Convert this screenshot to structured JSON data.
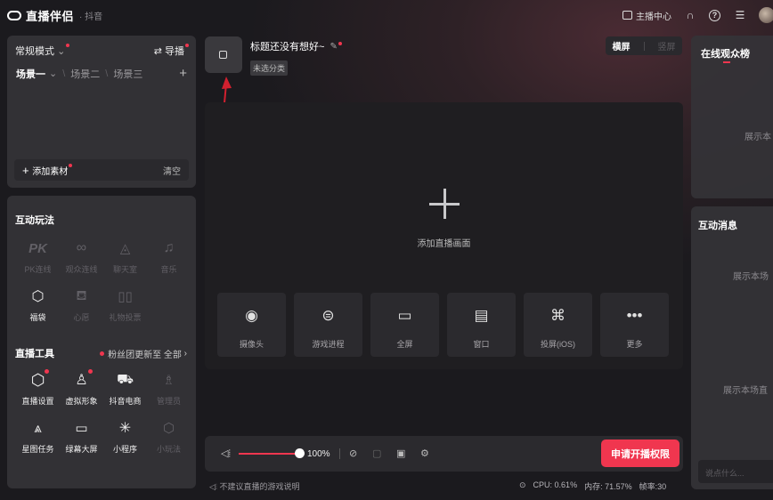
{
  "app": {
    "name": "直播伴侣",
    "platform": "· 抖音"
  },
  "titlebar": {
    "anchor_center": "主播中心",
    "help": "?"
  },
  "scene_panel": {
    "mode_label": "常规模式",
    "guide_label": "导播",
    "scenes": [
      "场景一",
      "场景二",
      "场景三"
    ],
    "add_material": "添加素材",
    "clear": "清空"
  },
  "interactive": {
    "title": "互动玩法",
    "items": [
      {
        "label": "PK连线",
        "icon": "pk-icon",
        "enabled": false
      },
      {
        "label": "观众连线",
        "icon": "link-icon",
        "enabled": false
      },
      {
        "label": "聊天室",
        "icon": "chatroom-icon",
        "enabled": false
      },
      {
        "label": "音乐",
        "icon": "music-icon",
        "enabled": false
      },
      {
        "label": "福袋",
        "icon": "lucky-bag-icon",
        "enabled": true
      },
      {
        "label": "心愿",
        "icon": "wish-icon",
        "enabled": false
      },
      {
        "label": "礼物投票",
        "icon": "gift-vote-icon",
        "enabled": false
      }
    ]
  },
  "tools": {
    "title": "直播工具",
    "fans_update": "粉丝团更新至",
    "all": "全部",
    "items": [
      {
        "label": "直播设置",
        "icon": "settings-icon",
        "enabled": true,
        "badge": true
      },
      {
        "label": "虚拟形象",
        "icon": "avatar-icon",
        "enabled": true,
        "badge": true
      },
      {
        "label": "抖音电商",
        "icon": "cart-icon",
        "enabled": true,
        "badge": false
      },
      {
        "label": "管理员",
        "icon": "admin-icon",
        "enabled": false,
        "badge": false
      },
      {
        "label": "星图任务",
        "icon": "star-task-icon",
        "enabled": true,
        "badge": false
      },
      {
        "label": "绿幕大屏",
        "icon": "green-screen-icon",
        "enabled": true,
        "badge": false
      },
      {
        "label": "小程序",
        "icon": "mini-program-icon",
        "enabled": true,
        "badge": false
      },
      {
        "label": "小玩法",
        "icon": "mini-game-icon",
        "enabled": false,
        "badge": false
      }
    ]
  },
  "stream": {
    "title": "标题还没有想好~",
    "category": "未选分类",
    "orientation": {
      "landscape": "横屏",
      "portrait": "竖屏"
    }
  },
  "canvas": {
    "add_label": "添加直播画面",
    "sources": [
      {
        "label": "摄像头",
        "icon": "camera-icon"
      },
      {
        "label": "游戏进程",
        "icon": "gamepad-icon"
      },
      {
        "label": "全屏",
        "icon": "monitor-icon"
      },
      {
        "label": "窗口",
        "icon": "window-icon"
      },
      {
        "label": "投屏(iOS)",
        "icon": "apple-icon"
      },
      {
        "label": "更多",
        "icon": "more-icon"
      }
    ]
  },
  "bottom": {
    "volume": 100,
    "volume_text": "100%",
    "apply_button": "申请开播权限"
  },
  "status": {
    "warning": "不建议直播的游戏说明",
    "cpu": "CPU: 0.61%",
    "memory": "内存: 71.57%",
    "fps": "帧率:30"
  },
  "audience": {
    "title": "在线观众榜",
    "empty": "展示本"
  },
  "messages": {
    "title": "互动消息",
    "empty1": "展示本场",
    "empty2": "展示本场直",
    "placeholder": "说点什么..."
  },
  "colors": {
    "accent": "#f0364f",
    "panel": "#343337",
    "background": "#1b1a1e"
  }
}
